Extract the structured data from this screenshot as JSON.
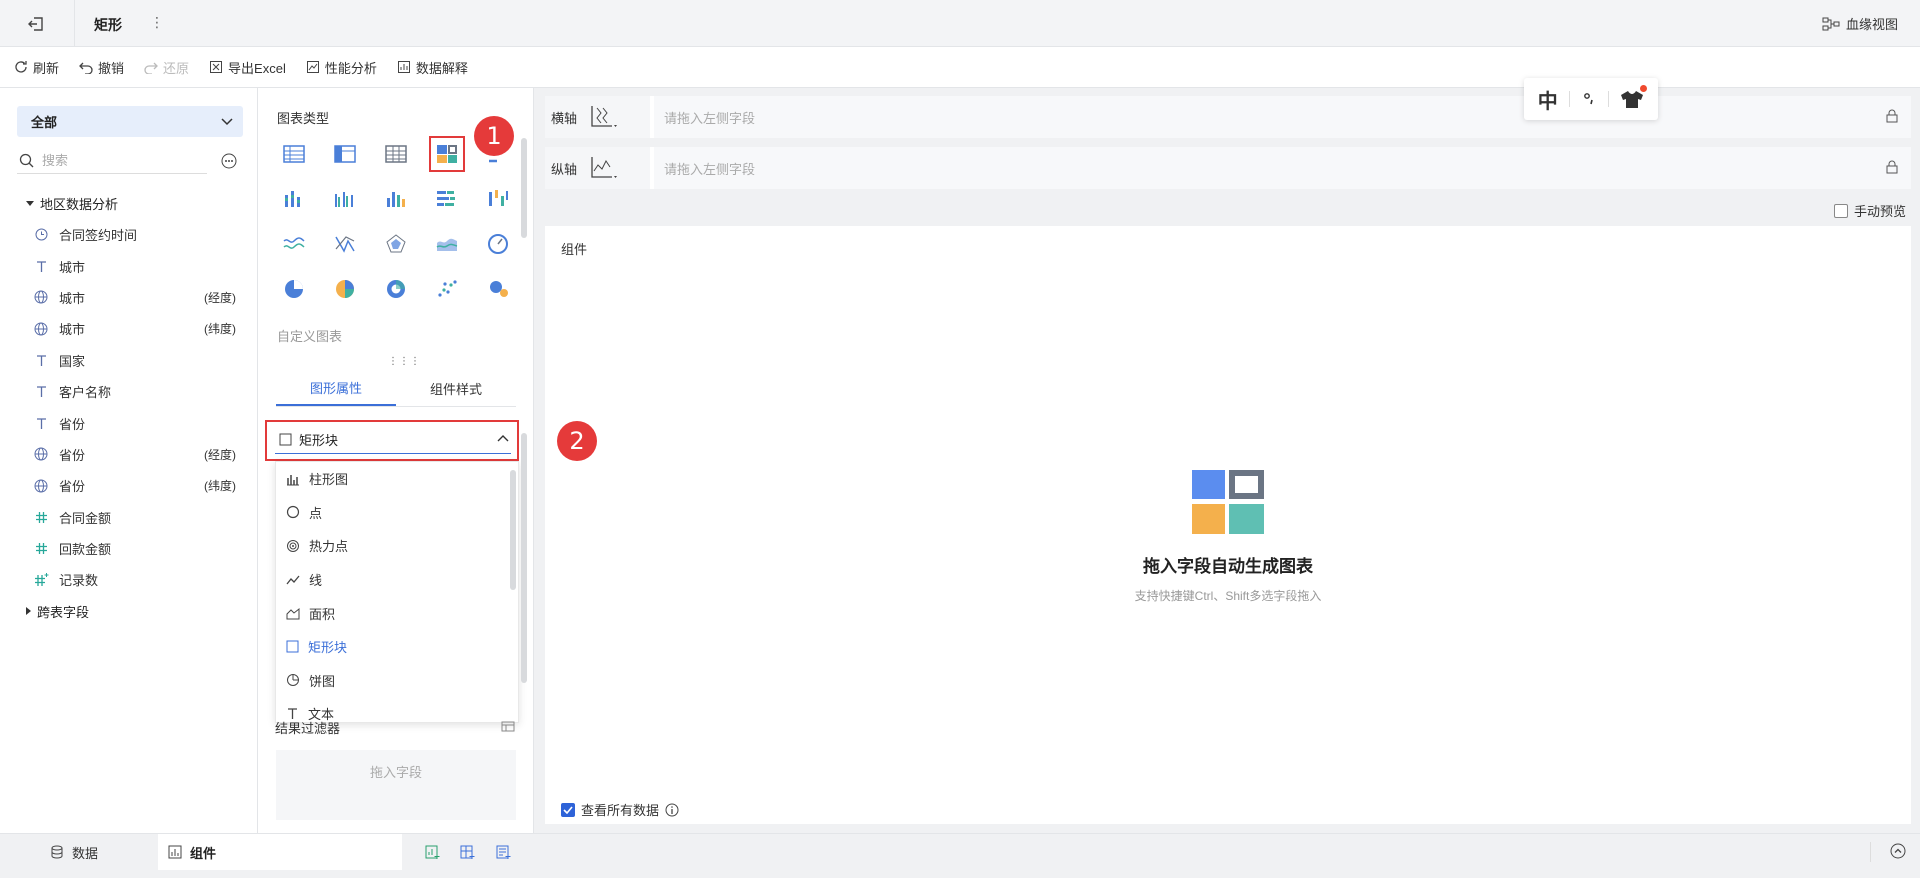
{
  "titlebar": {
    "title": "矩形",
    "lineage_label": "血缘视图"
  },
  "toolbar": {
    "refresh": "刷新",
    "undo": "撤销",
    "redo": "还原",
    "export_excel": "导出Excel",
    "performance": "性能分析",
    "data_explain": "数据解释"
  },
  "left": {
    "scope": "全部",
    "search_placeholder": "搜索",
    "group1": "地区数据分析",
    "fields": [
      {
        "icon": "clock-icon",
        "label": "合同签约时间",
        "suffix": ""
      },
      {
        "icon": "text-icon",
        "label": "城市",
        "suffix": ""
      },
      {
        "icon": "globe-icon",
        "label": "城市",
        "suffix": "(经度)"
      },
      {
        "icon": "globe-icon",
        "label": "城市",
        "suffix": "(纬度)"
      },
      {
        "icon": "text-icon",
        "label": "国家",
        "suffix": ""
      },
      {
        "icon": "text-icon",
        "label": "客户名称",
        "suffix": ""
      },
      {
        "icon": "text-icon",
        "label": "省份",
        "suffix": ""
      },
      {
        "icon": "globe-icon",
        "label": "省份",
        "suffix": "(经度)"
      },
      {
        "icon": "globe-icon",
        "label": "省份",
        "suffix": "(纬度)"
      },
      {
        "icon": "hash-icon",
        "label": "合同金额",
        "suffix": ""
      },
      {
        "icon": "hash-icon",
        "label": "回款金额",
        "suffix": ""
      },
      {
        "icon": "hash-plus-icon",
        "label": "记录数",
        "suffix": ""
      }
    ],
    "group2": "跨表字段"
  },
  "mid": {
    "chart_type_label": "图表类型",
    "custom_chart_label": "自定义图表",
    "tab_graph": "图形属性",
    "tab_style": "组件样式",
    "shape_selected": "矩形块",
    "dropdown": [
      {
        "icon": "bar-icon",
        "label": "柱形图"
      },
      {
        "icon": "point-icon",
        "label": "点"
      },
      {
        "icon": "heat-point-icon",
        "label": "热力点"
      },
      {
        "icon": "line-icon",
        "label": "线"
      },
      {
        "icon": "area-icon",
        "label": "面积"
      },
      {
        "icon": "rect-icon",
        "label": "矩形块"
      },
      {
        "icon": "pie-icon",
        "label": "饼图"
      },
      {
        "icon": "text-icon",
        "label": "文本"
      }
    ],
    "filter_label": "结果过滤器",
    "filter_drop": "拖入字段"
  },
  "main": {
    "x_axis": "横轴",
    "y_axis": "纵轴",
    "drop_placeholder": "请拖入左侧字段",
    "manual_preview": "手动预览",
    "component_label": "组件",
    "empty_title": "拖入字段自动生成图表",
    "empty_hint": "支持快捷键Ctrl、Shift多选字段拖入",
    "view_all": "查看所有数据"
  },
  "badges": {
    "one": "1",
    "two": "2"
  },
  "ime": {
    "lang": "中"
  },
  "bottom": {
    "data_tab": "数据",
    "component_tab": "组件"
  },
  "colors": {
    "accent": "#3b6fd8",
    "highlight": "#e23a3a",
    "tile_blue": "#5b8def",
    "tile_gray": "#6b7584",
    "tile_orange": "#f4b04c",
    "tile_teal": "#5fbfb3"
  }
}
